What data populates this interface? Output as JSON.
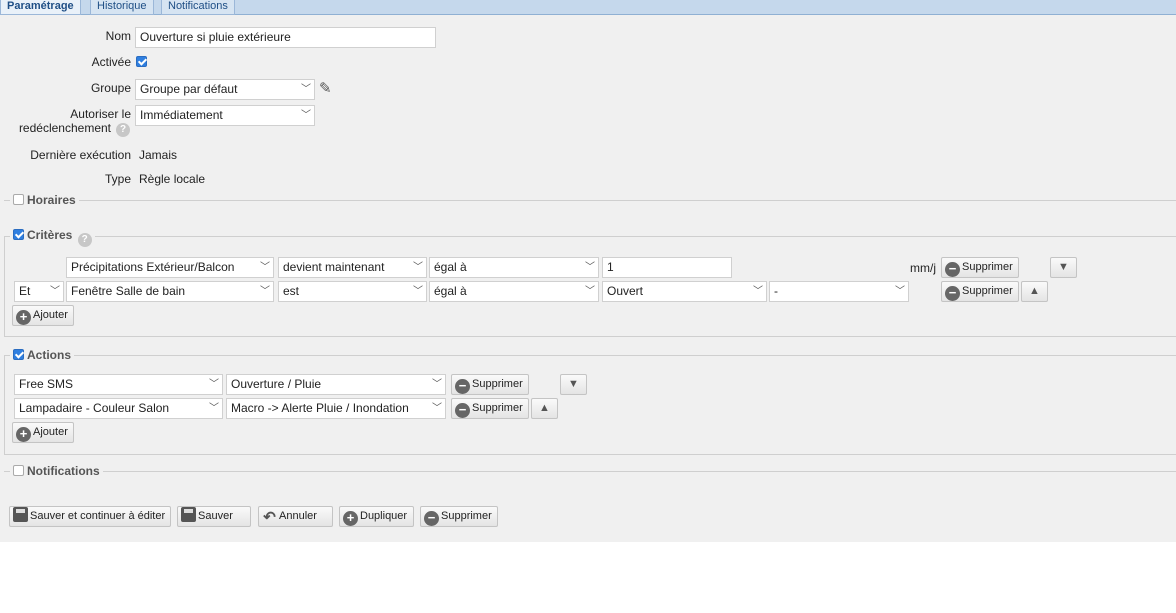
{
  "tabs": [
    {
      "label": "Paramétrage",
      "active": true
    },
    {
      "label": "Historique",
      "active": false
    },
    {
      "label": "Notifications",
      "active": false
    }
  ],
  "form": {
    "nom_label": "Nom",
    "nom_value": "Ouverture si pluie extérieure",
    "activee_label": "Activée",
    "activee_checked": true,
    "groupe_label": "Groupe",
    "groupe_value": "Groupe par défaut",
    "autoriser_label_1": "Autoriser le",
    "autoriser_label_2": "redéclenchement",
    "autoriser_value": "Immédiatement",
    "derniere_label": "Dernière exécution",
    "derniere_value": "Jamais",
    "type_label": "Type",
    "type_value": "Règle locale"
  },
  "sections": {
    "horaires": "Horaires",
    "criteres": "Critères",
    "actions": "Actions",
    "notifications": "Notifications"
  },
  "criteria": [
    {
      "connector": "",
      "device": "Précipitations Extérieur/Balcon",
      "event": "devient maintenant",
      "operator": "égal à",
      "value": "1",
      "unit": "mm/j",
      "extra": "",
      "delete": "Supprimer",
      "arrow": "down"
    },
    {
      "connector": "Et",
      "device": "Fenêtre Salle de bain",
      "event": "est",
      "operator": "égal à",
      "value": "Ouvert",
      "unit": "",
      "extra": "-",
      "delete": "Supprimer",
      "arrow": "up"
    }
  ],
  "actions": [
    {
      "target": "Free SMS",
      "action": "Ouverture / Pluie",
      "delete": "Supprimer",
      "arrow": "down"
    },
    {
      "target": "Lampadaire - Couleur Salon",
      "action": "Macro -> Alerte Pluie / Inondation",
      "delete": "Supprimer",
      "arrow": "up"
    }
  ],
  "add_label": "Ajouter",
  "footer": {
    "save_continue": "Sauver et continuer à éditer",
    "save": "Sauver",
    "cancel": "Annuler",
    "duplicate": "Dupliquer",
    "delete": "Supprimer"
  },
  "icons": {
    "help": "question-circle-icon",
    "edit": "pencil-icon",
    "remove": "minus-circle-icon",
    "add": "plus-circle-icon"
  },
  "colors": {
    "tabbar": "#c5d8ec",
    "panel": "#f0f0f0",
    "checkbox": "#2f7fe0"
  }
}
